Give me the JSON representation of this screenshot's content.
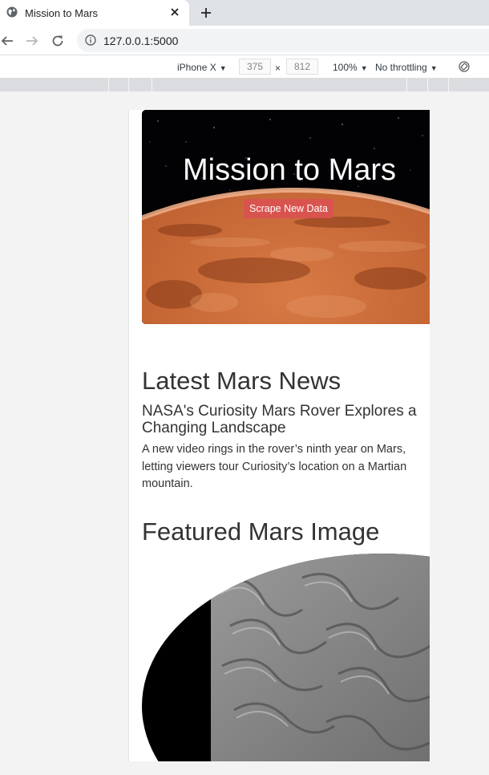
{
  "browser": {
    "tab_title": "Mission to Mars",
    "url": "127.0.0.1:5000"
  },
  "devtools": {
    "device": "iPhone X",
    "width": "375",
    "times": "×",
    "height": "812",
    "zoom": "100%",
    "throttling": "No throttling"
  },
  "page": {
    "title": "Mission to Mars",
    "scrape_button": "Scrape New Data",
    "news_heading": "Latest Mars News",
    "news_title": "NASA's Curiosity Mars Rover Explores a Changing Landscape",
    "news_paragraph": "A new video rings in the rover’s ninth year on Mars, letting viewers tour Curiosity’s location on a Martian mountain.",
    "featured_heading": "Featured Mars Image"
  }
}
